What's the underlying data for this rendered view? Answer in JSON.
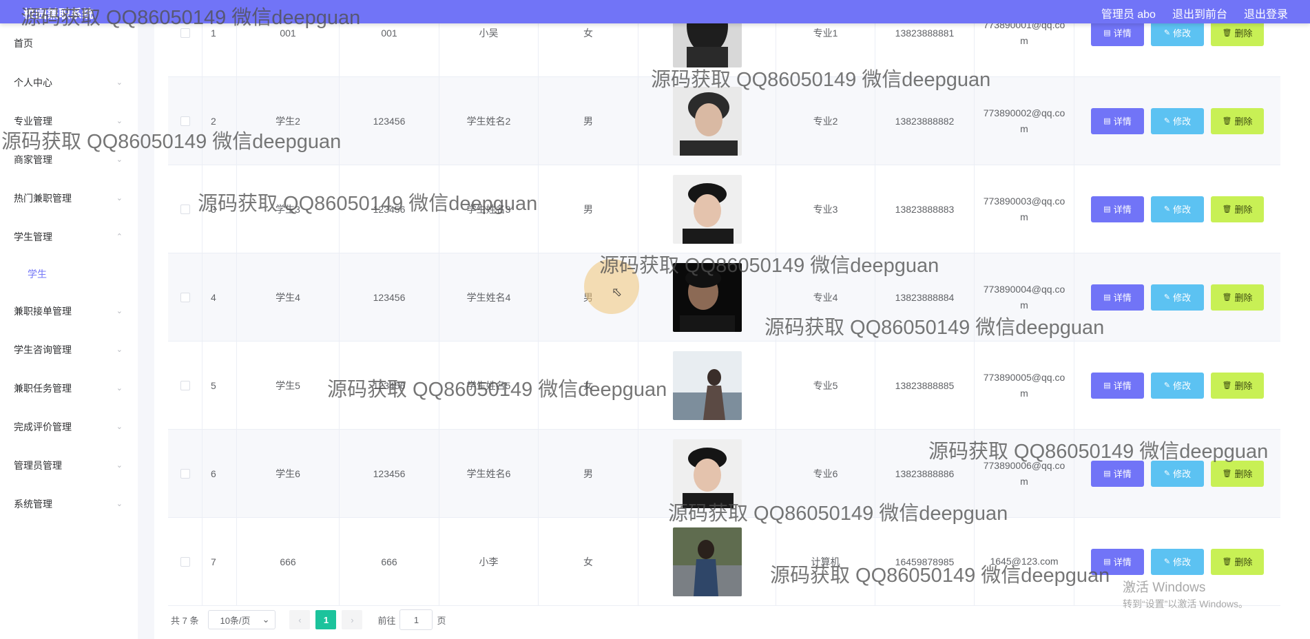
{
  "header": {
    "brand": "校园兼职系统",
    "admin_label": "管理员 abo",
    "front_link": "退出到前台",
    "logout_link": "退出登录"
  },
  "sidebar": {
    "items": [
      {
        "label": "首页"
      },
      {
        "label": "个人中心"
      },
      {
        "label": "专业管理"
      },
      {
        "label": "商家管理"
      },
      {
        "label": "热门兼职管理"
      },
      {
        "label": "学生管理"
      },
      {
        "label": "学生",
        "sub": true
      },
      {
        "label": "兼职接单管理"
      },
      {
        "label": "学生咨询管理"
      },
      {
        "label": "兼职任务管理"
      },
      {
        "label": "完成评价管理"
      },
      {
        "label": "管理员管理"
      },
      {
        "label": "系统管理"
      }
    ]
  },
  "table": {
    "rows": [
      {
        "index": "1",
        "account": "001",
        "password": "001",
        "name": "小吴",
        "gender": "女",
        "photo": "photo-dark-hair",
        "major": "专业1",
        "phone": "13823888881",
        "email": "773890001@qq.com"
      },
      {
        "index": "2",
        "account": "学生2",
        "password": "123456",
        "name": "学生姓名2",
        "gender": "男",
        "photo": "photo-man-dark",
        "major": "专业2",
        "phone": "13823888882",
        "email": "773890002@qq.com"
      },
      {
        "index": "3",
        "account": "学生3",
        "password": "123456",
        "name": "学生姓名3",
        "gender": "男",
        "photo": "photo-man-cap",
        "major": "专业3",
        "phone": "13823888883",
        "email": "773890003@qq.com"
      },
      {
        "index": "4",
        "account": "学生4",
        "password": "123456",
        "name": "学生姓名4",
        "gender": "男",
        "photo": "photo-man-shadow",
        "major": "专业4",
        "phone": "13823888884",
        "email": "773890004@qq.com"
      },
      {
        "index": "5",
        "account": "学生5",
        "password": "123456",
        "name": "学生姓名5",
        "gender": "女",
        "photo": "photo-woman-sea",
        "major": "专业5",
        "phone": "13823888885",
        "email": "773890005@qq.com"
      },
      {
        "index": "6",
        "account": "学生6",
        "password": "123456",
        "name": "学生姓名6",
        "gender": "男",
        "photo": "photo-man-cap",
        "major": "专业6",
        "phone": "13823888886",
        "email": "773890006@qq.com"
      },
      {
        "index": "7",
        "account": "666",
        "password": "666",
        "name": "小李",
        "gender": "女",
        "photo": "photo-woman-road",
        "major": "计算机",
        "phone": "16459878985",
        "email": "1645@123.com"
      }
    ],
    "actions": {
      "detail": "详情",
      "edit": "修改",
      "delete": "删除"
    }
  },
  "pagination": {
    "total": "共 7 条",
    "page_size": "10条/页",
    "current_page": "1",
    "goto_prefix": "前往",
    "goto_value": "1",
    "goto_suffix": "页"
  },
  "activation": {
    "title": "激活 Windows",
    "subtitle": "转到“设置”以激活 Windows。"
  },
  "watermark": "源码获取 QQ86050149 微信deepguan",
  "colors": {
    "accent": "#7174f7",
    "detail": "#7174f7",
    "edit": "#5cc2f2",
    "delete": "#c8f055",
    "pager_active": "#1cc39c"
  }
}
